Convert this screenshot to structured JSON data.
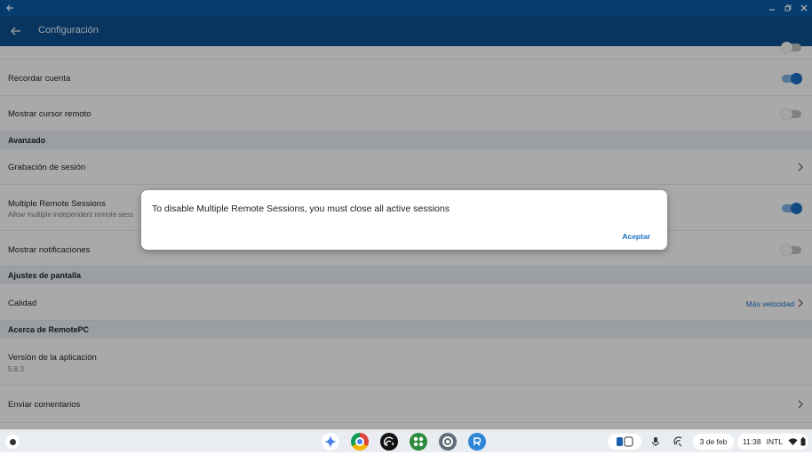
{
  "appbar": {
    "title": "Configuración"
  },
  "rows": {
    "recordar_cuenta": {
      "label": "Recordar cuenta",
      "toggle": "on"
    },
    "mostrar_cursor": {
      "label": "Mostrar cursor remoto",
      "toggle": "off"
    },
    "grabacion": {
      "label": "Grabación de sesión"
    },
    "multiple": {
      "label": "Multiple Remote Sessions",
      "sub": "Allow multiple independent remote sess",
      "toggle": "on"
    },
    "notificaciones": {
      "label": "Mostrar notificaciones",
      "toggle": "off"
    },
    "calidad": {
      "label": "Calidad",
      "value": "Más velocidad"
    },
    "version": {
      "label": "Versión de la aplicación",
      "sub": "5.8.3"
    },
    "comentarios": {
      "label": "Enviar comentarios"
    }
  },
  "sections": {
    "avanzado": "Avanzado",
    "pantalla": "Ajustes de pantalla",
    "acerca": "Acerca de RemotePC"
  },
  "dialog": {
    "message": "To disable Multiple Remote Sessions, you must close all active sessions",
    "ok_label": "Aceptar"
  },
  "shelf": {
    "apps": [
      "gemini-icon",
      "chrome-icon",
      "podcast-icon",
      "play-apps-icon",
      "settings-icon",
      "remotepc-icon"
    ],
    "date": "3 de feb",
    "time": "11:38",
    "input_method": "INTL"
  },
  "colors": {
    "titlebar": "#0a5aa7",
    "appbar": "#0b4f8e",
    "accent": "#1b6fc0"
  }
}
